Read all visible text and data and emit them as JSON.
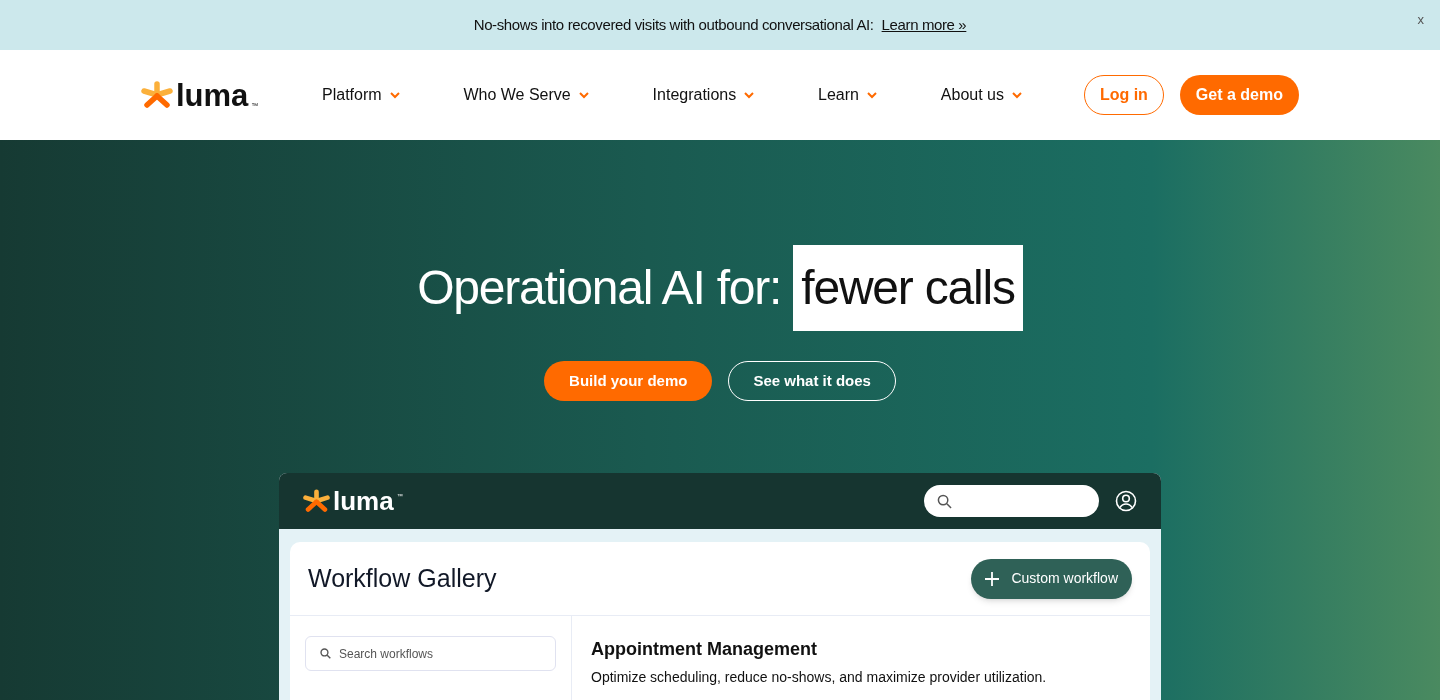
{
  "banner": {
    "text": "No-shows into recovered visits with outbound conversational AI:",
    "link": "Learn more »",
    "close": "x"
  },
  "header": {
    "logo": "luma",
    "logo_mark": "™",
    "nav": [
      {
        "label": "Platform"
      },
      {
        "label": "Who We Serve"
      },
      {
        "label": "Integrations"
      },
      {
        "label": "Learn"
      },
      {
        "label": "About us"
      }
    ],
    "login": "Log in",
    "cta": "Get a demo"
  },
  "hero": {
    "headline": "Operational AI for:",
    "highlight": "fewer calls",
    "primary_button": "Build your demo",
    "secondary_button": "See what it does"
  },
  "app": {
    "logo": "luma",
    "logo_mark": "™",
    "title": "Workflow Gallery",
    "action_button": "Custom workflow",
    "search_placeholder": "Search workflows",
    "section_title": "Appointment Management",
    "section_description": "Optimize scheduling, reduce no-shows, and maximize provider utilization."
  }
}
